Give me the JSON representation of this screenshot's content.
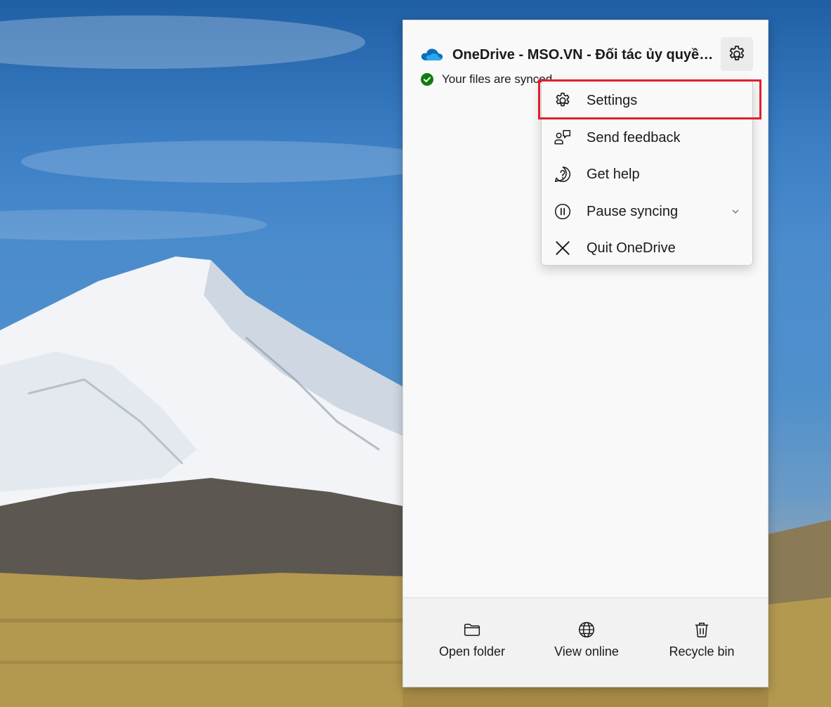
{
  "window": {
    "title": "OneDrive - MSO.VN - Đối tác ủy quyền Microsoft",
    "status_text": "Your files are synced",
    "icons": {
      "cloud": "onedrive-cloud-icon",
      "status": "check-circle-icon",
      "settings": "gear-icon"
    }
  },
  "menu": {
    "items": [
      {
        "label": "Settings",
        "icon": "gear-icon",
        "highlighted": true
      },
      {
        "label": "Send feedback",
        "icon": "feedback-icon"
      },
      {
        "label": "Get help",
        "icon": "help-icon"
      },
      {
        "label": "Pause syncing",
        "icon": "pause-icon",
        "has_submenu": true
      },
      {
        "label": "Quit OneDrive",
        "icon": "close-icon"
      }
    ]
  },
  "footer": {
    "buttons": [
      {
        "label": "Open folder",
        "icon": "folder-icon"
      },
      {
        "label": "View online",
        "icon": "globe-icon"
      },
      {
        "label": "Recycle bin",
        "icon": "trash-icon"
      }
    ]
  },
  "colors": {
    "highlight": "#e0202c",
    "onedrive_blue": "#0f6cbd",
    "synced_green": "#0f7b0f"
  }
}
